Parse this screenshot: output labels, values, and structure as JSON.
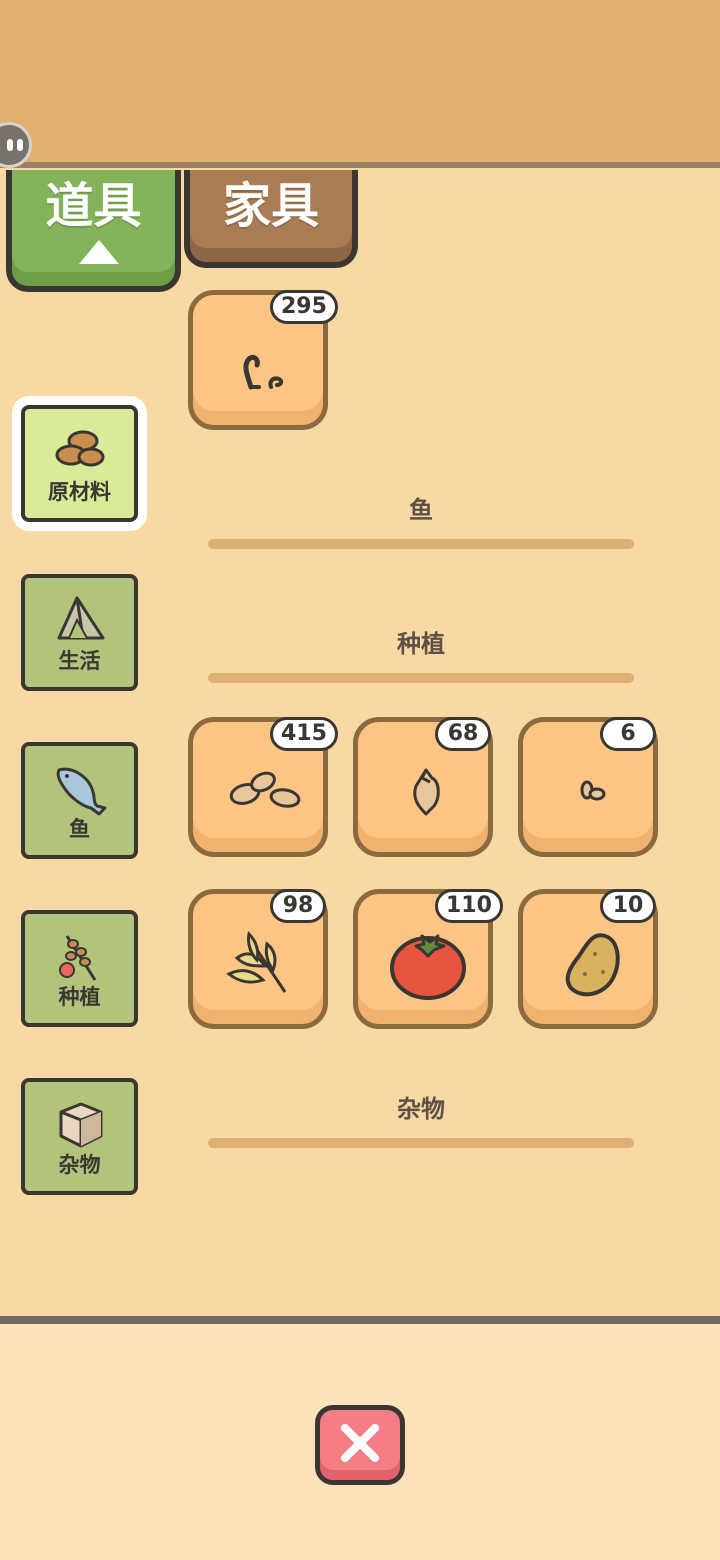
{
  "tabs": [
    {
      "label": "道具",
      "active": true
    },
    {
      "label": "家具",
      "active": false
    }
  ],
  "categories": [
    {
      "label": "原材料",
      "icon": "nuts-icon",
      "selected": true
    },
    {
      "label": "生活",
      "icon": "tent-icon",
      "selected": false
    },
    {
      "label": "鱼",
      "icon": "fish-icon",
      "selected": false
    },
    {
      "label": "种植",
      "icon": "plant-icon",
      "selected": false
    },
    {
      "label": "杂物",
      "icon": "box-icon",
      "selected": false
    }
  ],
  "sections": {
    "raw": {
      "items": [
        {
          "icon": "twig-icon",
          "count": "295"
        }
      ]
    },
    "fish": {
      "title": "鱼",
      "items": []
    },
    "planting": {
      "title": "种植",
      "items": [
        {
          "icon": "seeds-icon",
          "count": "415"
        },
        {
          "icon": "bulb-seed-icon",
          "count": "68"
        },
        {
          "icon": "small-seed-icon",
          "count": "6"
        },
        {
          "icon": "wheat-icon",
          "count": "98"
        },
        {
          "icon": "tomato-icon",
          "count": "110"
        },
        {
          "icon": "potato-icon",
          "count": "10"
        }
      ]
    },
    "misc": {
      "title": "杂物",
      "items": []
    }
  },
  "colors": {
    "background": "#f8d9a3",
    "banner": "#e0b06f",
    "active_tab": "#83b45a",
    "inactive_tab": "#a87d54",
    "slot": "#fcc584",
    "close_button": "#f47d86"
  }
}
